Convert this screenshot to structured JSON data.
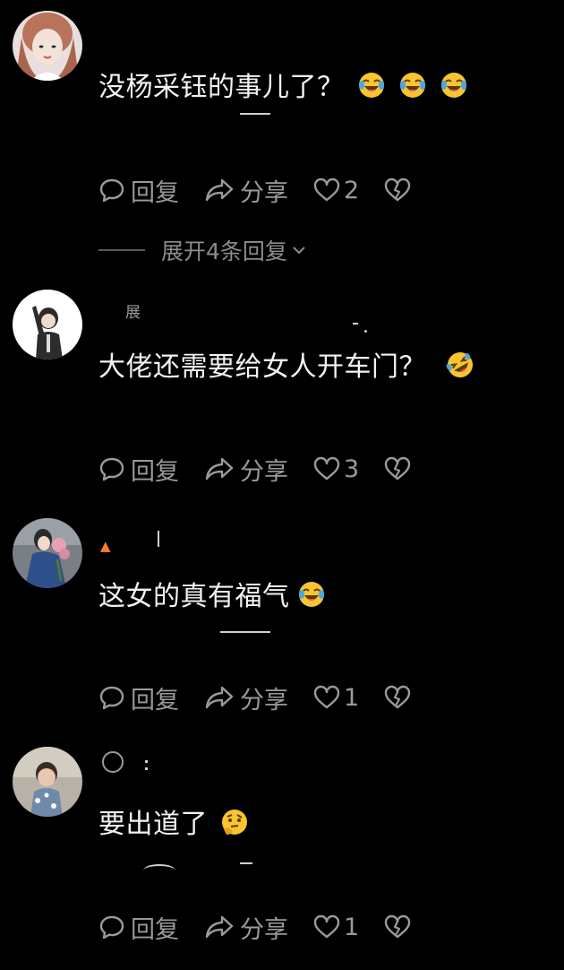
{
  "comments": [
    {
      "text": "没杨采钰的事儿了？",
      "emojis": [
        "laugh-cry-emoji",
        "laugh-cry-emoji",
        "laugh-cry-emoji"
      ],
      "reply_label": "回复",
      "share_label": "分享",
      "like_count": "2"
    },
    {
      "text": "大佬还需要给女人开车门？",
      "emojis": [
        "rolling-laugh-emoji"
      ],
      "reply_label": "回复",
      "share_label": "分享",
      "like_count": "3"
    },
    {
      "text": "这女的真有福气",
      "emojis": [
        "laugh-cry-emoji"
      ],
      "reply_label": "回复",
      "share_label": "分享",
      "like_count": "1"
    },
    {
      "text": "要出道了",
      "emojis": [
        "thinking-emoji"
      ],
      "reply_label": "回复",
      "share_label": "分享",
      "like_count": "1"
    }
  ],
  "expand_replies": "展开4条回复",
  "colors": {
    "background": "#000000",
    "text": "#f2f2f2",
    "muted": "#9a9a9a",
    "emoji_yellow": "#f7c531"
  }
}
